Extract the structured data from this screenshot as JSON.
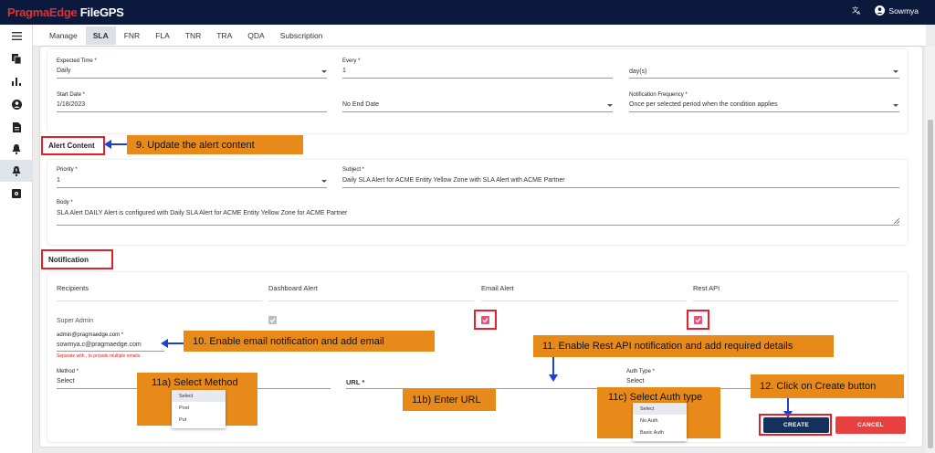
{
  "app": {
    "brand_red": "PragmaEdge",
    "brand_white": " FileGPS",
    "user": "Sowmya"
  },
  "tabs": [
    {
      "label": "Manage"
    },
    {
      "label": "SLA"
    },
    {
      "label": "FNR"
    },
    {
      "label": "FLA"
    },
    {
      "label": "TNR"
    },
    {
      "label": "TRA"
    },
    {
      "label": "QDA"
    },
    {
      "label": "Subscription"
    }
  ],
  "schedule": {
    "expected_time_label": "Expected Time *",
    "expected_time_value": "Daily",
    "every_label": "Every *",
    "every_value": "1",
    "unit_value": "day(s)",
    "start_date_label": "Start Date *",
    "start_date_value": "1/18/2023",
    "end_date_value": "No End Date",
    "notif_freq_label": "Notification Frequency *",
    "notif_freq_value": "Once per selected period when the condition applies"
  },
  "alert_content": {
    "title": "Alert Content",
    "priority_label": "Priority *",
    "priority_value": "1",
    "subject_label": "Subject *",
    "subject_value": "Daily SLA Alert for ACME Entity Yellow Zone with SLA Alert with ACME Partner",
    "body_label": "Body *",
    "body_value": "SLA Alert DAILY Alert is configured with Daily SLA Alert for ACME Entity Yellow Zone for ACME Partner"
  },
  "notification": {
    "title": "Notification",
    "headers": [
      "Recipients",
      "Dashboard Alert",
      "Email Alert",
      "Rest API"
    ],
    "recipient": "Super Admin",
    "email_label": "admin@pragmaedge.com *",
    "email_value": "sowmya.c@pragmaedge.com",
    "email_hint": "Separate with , to provide multiple emails.",
    "method_label": "Method *",
    "method_value": "Select",
    "method_options": [
      "Select",
      "Post",
      "Put"
    ],
    "url_label": "URL *",
    "auth_label": "Auth Type *",
    "auth_value": "Select",
    "auth_options": [
      "Select",
      "No Auth",
      "Basic Auth"
    ]
  },
  "buttons": {
    "create": "CREATE",
    "cancel": "CANCEL"
  },
  "callouts": {
    "c9": "9. Update the alert content",
    "c10": "10. Enable email notification and add email",
    "c11": "11. Enable Rest API notification and add required details",
    "c11a": "11a) Select Method",
    "c11b": "11b) Enter URL",
    "c11c": "11c) Select Auth type",
    "c12": "12. Click on Create button"
  },
  "colors": {
    "navy": "#0b1a3c",
    "accent_pink": "#e8537a",
    "create_bg": "#14305c",
    "cancel_bg": "#e8403e",
    "callout": "#e88a1a",
    "highlight": "#e5202b"
  }
}
